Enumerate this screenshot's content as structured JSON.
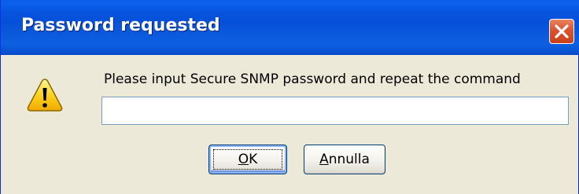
{
  "dialog": {
    "title": "Password requested",
    "message": "Please input Secure SNMP password and repeat the command",
    "password_value": "",
    "ok_accel": "O",
    "ok_rest": "K",
    "cancel_accel": "A",
    "cancel_rest": "nnulla",
    "close_icon": "close-icon",
    "warning_icon": "warning-icon"
  },
  "colors": {
    "titlebar": "#0a5ee8",
    "close_button": "#d9542f",
    "dialog_background": "#ece9d8",
    "warning_yellow": "#ffd21f"
  }
}
